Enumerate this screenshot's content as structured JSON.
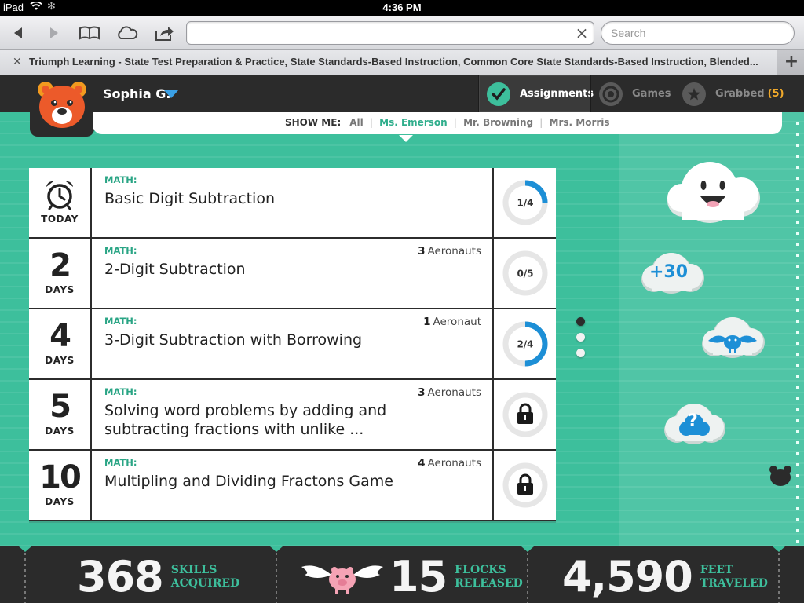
{
  "status_bar": {
    "device": "iPad",
    "time": "4:36 PM"
  },
  "browser": {
    "url_value": "",
    "search_placeholder": "Search",
    "tab_title": "Triumph Learning - State Test Preparation & Practice, State Standards-Based Instruction, Common Core State Standards-Based Instruction, Blended..."
  },
  "user": {
    "name": "Sophia G."
  },
  "nav": {
    "assignments": "Assignments",
    "games": "Games",
    "grabbed": "Grabbed",
    "grabbed_count": "(5)"
  },
  "filter": {
    "label": "SHOW ME:",
    "options": [
      "All",
      "Ms. Emerson",
      "Mr. Browning",
      "Mrs. Morris"
    ],
    "active": "Ms. Emerson"
  },
  "assignments": [
    {
      "due_num": "",
      "due_unit": "TODAY",
      "due_icon": "alarm-clock-icon",
      "subject": "MATH:",
      "title": "Basic Digit Subtraction",
      "aeronauts_count": "",
      "aeronauts_label": "",
      "progress": "1/4",
      "done": 1,
      "total": 4,
      "locked": false
    },
    {
      "due_num": "2",
      "due_unit": "DAYS",
      "subject": "MATH:",
      "title": "2-Digit Subtraction",
      "aeronauts_count": "3",
      "aeronauts_label": "Aeronauts",
      "progress": "0/5",
      "done": 0,
      "total": 5,
      "locked": false
    },
    {
      "due_num": "4",
      "due_unit": "DAYS",
      "subject": "MATH:",
      "title": "3-Digit Subtraction with Borrowing",
      "aeronauts_count": "1",
      "aeronauts_label": "Aeronaut",
      "progress": "2/4",
      "done": 2,
      "total": 4,
      "locked": false
    },
    {
      "due_num": "5",
      "due_unit": "DAYS",
      "subject": "MATH:",
      "title": "Solving word problems by adding and subtracting fractions with unlike ...",
      "aeronauts_count": "3",
      "aeronauts_label": "Aeronauts",
      "progress": "",
      "locked": true
    },
    {
      "due_num": "10",
      "due_unit": "DAYS",
      "subject": "MATH:",
      "title": "Multipling and Dividing Fractons Game",
      "aeronauts_count": "4",
      "aeronauts_label": "Aeronauts",
      "progress": "",
      "locked": true
    }
  ],
  "pager": {
    "pages": 3,
    "active": 1
  },
  "clouds": {
    "points_badge": "+30",
    "question_badge": "?"
  },
  "stats": {
    "skills": {
      "value": "368",
      "label_1": "SKILLS",
      "label_2": "ACQUIRED"
    },
    "flocks": {
      "value": "15",
      "label_1": "FLOCKS",
      "label_2": "RELEASED"
    },
    "feet": {
      "value": "4,590",
      "label_1": "FEET",
      "label_2": "TRAVELED"
    }
  },
  "colors": {
    "teal": "#3dbf9c",
    "progress_blue": "#1d8fd6",
    "orange_bear": "#ec5a2a",
    "grabbed_orange": "#f0a92b"
  }
}
